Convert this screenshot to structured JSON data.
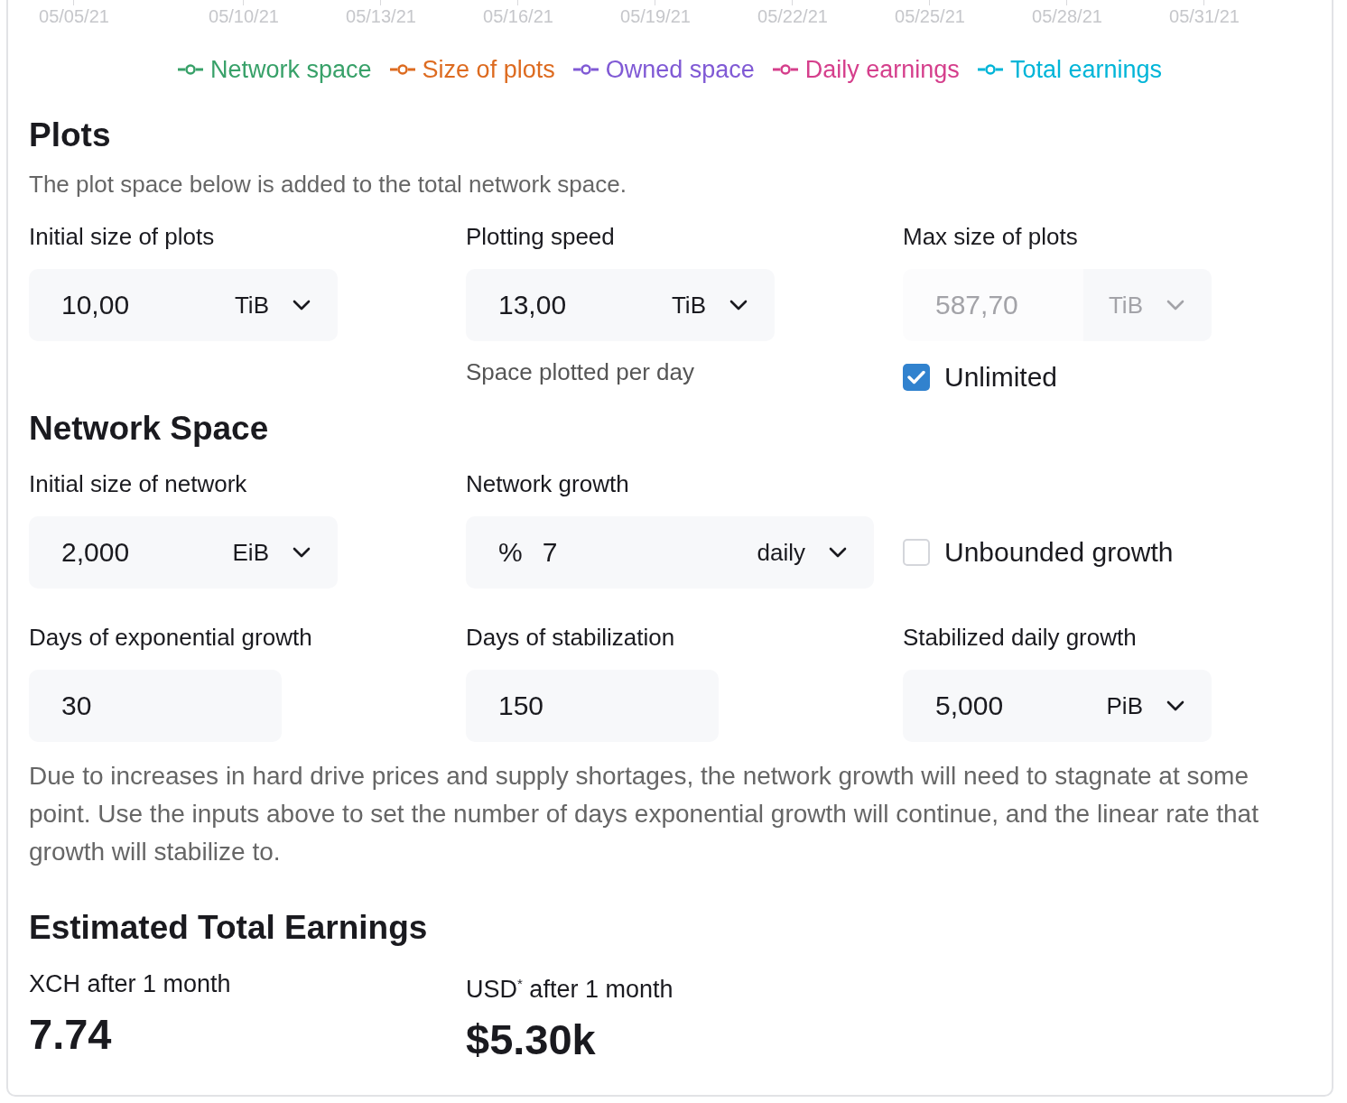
{
  "chart_axis": {
    "ticks": [
      "05/05/21",
      "05/10/21",
      "05/13/21",
      "05/16/21",
      "05/19/21",
      "05/22/21",
      "05/25/21",
      "05/28/21",
      "05/31/21"
    ]
  },
  "legend": [
    {
      "label": "Network space",
      "color": "#38a169"
    },
    {
      "label": "Size of plots",
      "color": "#dd6b20"
    },
    {
      "label": "Owned space",
      "color": "#805ad5"
    },
    {
      "label": "Daily earnings",
      "color": "#d53f8c"
    },
    {
      "label": "Total earnings",
      "color": "#00b5d8"
    }
  ],
  "sections": [
    {
      "title": "Plots",
      "description": "The plot space below is added to the total network space.",
      "rows": [
        [
          {
            "kind": "input",
            "label": "Initial size of plots",
            "field": {
              "value": "10,00",
              "unit": "TiB",
              "disabled": false
            }
          },
          {
            "kind": "input",
            "label": "Plotting speed",
            "field": {
              "value": "13,00",
              "unit": "TiB",
              "disabled": false
            },
            "hint": "Space plotted per day"
          },
          {
            "kind": "input",
            "label": "Max size of plots",
            "field": {
              "value": "587,70",
              "unit": "TiB",
              "disabled": true
            },
            "checkbox": {
              "label": "Unlimited",
              "checked": true
            }
          }
        ]
      ]
    },
    {
      "title": "Network Space",
      "rows": [
        [
          {
            "kind": "input",
            "label": "Initial size of network",
            "field": {
              "value": "2,000",
              "unit": "EiB",
              "disabled": false
            }
          },
          {
            "kind": "input",
            "label": "Network growth",
            "field": {
              "prefix": "%",
              "value": "7",
              "unit": "daily",
              "disabled": false
            }
          },
          {
            "kind": "checkbox",
            "checkbox": {
              "label": "Unbounded growth",
              "checked": false
            }
          }
        ],
        [
          {
            "kind": "input",
            "label": "Days of exponential growth",
            "field": {
              "value": "30",
              "disabled": false
            }
          },
          {
            "kind": "input",
            "label": "Days of stabilization",
            "field": {
              "value": "150",
              "disabled": false
            }
          },
          {
            "kind": "input",
            "label": "Stabilized daily growth",
            "field": {
              "value": "5,000",
              "unit": "PiB",
              "disabled": false
            }
          }
        ]
      ],
      "note": "Due to increases in hard drive prices and supply shortages, the network growth will need to stagnate at some point. Use the inputs above to set the number of days exponential growth will continue, and the linear rate that growth will stabilize to."
    }
  ],
  "earnings": {
    "title": "Estimated Total Earnings",
    "results": [
      {
        "label": "XCH after 1 month",
        "value": "7.74"
      },
      {
        "label": "USD$^{*}$ after 1 month",
        "value": "$5.30k"
      }
    ]
  }
}
